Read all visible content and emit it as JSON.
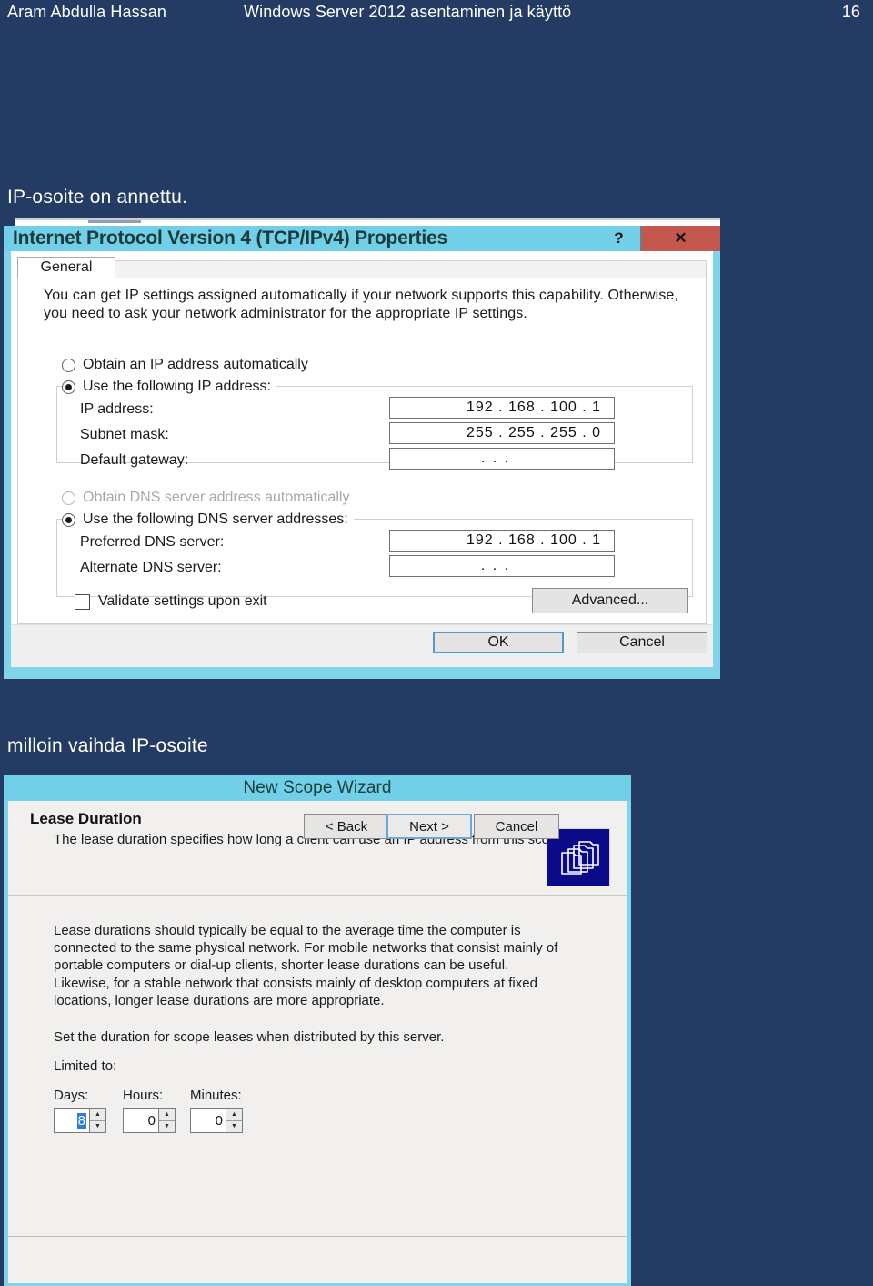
{
  "header": {
    "author": "Aram Abdulla Hassan",
    "doc_title": "Windows Server 2012 asentaminen ja käyttö",
    "page_number": "16",
    "bg_color": "#243b64",
    "text_color": "#ffffff"
  },
  "captions": {
    "caption_1": "IP-osoite on annettu.",
    "caption_2": "milloin vaihda IP-osoite"
  },
  "ipv4_dialog": {
    "title": "Internet Protocol Version 4 (TCP/IPv4) Properties",
    "titlebar_color": "#72cfe8",
    "close_color": "#c4584f",
    "help_button": "?",
    "close_button": "✕",
    "tab_general": "General",
    "intro_text": "You can get IP settings assigned automatically if your network supports this capability. Otherwise, you need to ask your network administrator for the appropriate IP settings.",
    "radio_obtain_ip": "Obtain an IP address automatically",
    "radio_use_ip": "Use the following IP address:",
    "label_ip_address": "IP address:",
    "value_ip_address": "192 . 168 . 100 .   1",
    "label_subnet_mask": "Subnet mask:",
    "value_subnet_mask": "255 . 255 . 255 .   0",
    "label_default_gateway": "Default gateway:",
    "value_default_gateway": ".        .        .",
    "radio_obtain_dns": "Obtain DNS server address automatically",
    "radio_use_dns": "Use the following DNS server addresses:",
    "label_preferred_dns": "Preferred DNS server:",
    "value_preferred_dns": "192 . 168 . 100 .   1",
    "label_alternate_dns": "Alternate DNS server:",
    "value_alternate_dns": ".        .        .",
    "checkbox_validate": "Validate settings upon exit",
    "button_advanced": "Advanced...",
    "button_ok": "OK",
    "button_cancel": "Cancel"
  },
  "wizard_dialog": {
    "title": "New Scope Wizard",
    "titlebar_color": "#72cfe8",
    "head_title": "Lease Duration",
    "head_subtitle": "The lease duration specifies how long a client can use an IP address from this scope.",
    "icon": "folders-icon",
    "paragraph": "Lease durations should typically be equal to the average time the computer is connected to the same physical network. For mobile networks that consist mainly of portable computers or dial-up clients, shorter lease durations can be useful. Likewise, for a stable network that consists mainly of desktop computers at fixed locations, longer lease durations are more appropriate.",
    "set_duration_line": "Set the duration for scope leases when distributed by this server.",
    "limited_to_label": "Limited to:",
    "spinners": [
      {
        "label": "Days:",
        "value": "8"
      },
      {
        "label": "Hours:",
        "value": "0"
      },
      {
        "label": "Minutes:",
        "value": "0"
      }
    ],
    "button_back": "< Back",
    "button_next": "Next >",
    "button_cancel": "Cancel"
  }
}
